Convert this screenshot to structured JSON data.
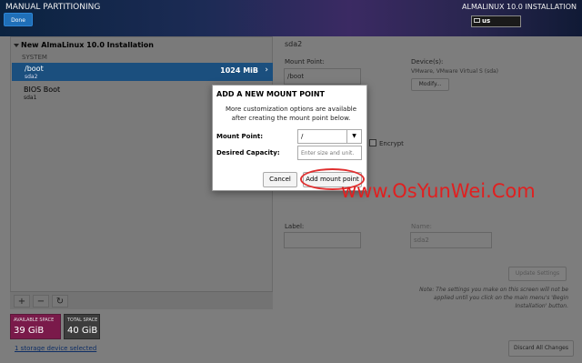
{
  "header": {
    "title": "MANUAL PARTITIONING",
    "done_label": "Done",
    "product": "ALMALINUX 10.0 INSTALLATION",
    "keyboard": "us"
  },
  "left_panel": {
    "install_title": "New AlmaLinux 10.0 Installation",
    "system_label": "SYSTEM",
    "selected": {
      "mount": "/boot",
      "device": "sda2",
      "size": "1024 MiB"
    },
    "items": [
      {
        "mount": "BIOS Boot",
        "device": "sda1"
      }
    ],
    "tools": {
      "add": "+",
      "remove": "−",
      "refresh": "↻"
    },
    "available_label": "AVAILABLE SPACE",
    "available_value": "39 GiB",
    "total_label": "TOTAL SPACE",
    "total_value": "40 GiB",
    "storage_link": "1 storage device selected"
  },
  "right_panel": {
    "title": "sda2",
    "mount_label": "Mount Point:",
    "mount_value": "/boot",
    "devices_label": "Device(s):",
    "devices_value": "VMware, VMware Virtual S (sda)",
    "modify_label": "Modify...",
    "encrypt_label": "Encrypt",
    "label_label": "Label:",
    "name_label": "Name:",
    "name_value": "sda2",
    "update_label": "Update Settings",
    "note": "Note: The settings you make on this screen will not be applied until you click on the main menu's 'Begin Installation' button.",
    "discard_label": "Discard All Changes"
  },
  "dialog": {
    "title": "ADD A NEW MOUNT POINT",
    "description": "More customization options are available after creating the mount point below.",
    "mount_label": "Mount Point:",
    "mount_value": "/",
    "capacity_label": "Desired Capacity:",
    "capacity_placeholder": "Enter size and unit.",
    "cancel_label": "Cancel",
    "add_label": "Add mount point"
  },
  "watermark": "www.OsYunWei.Com",
  "colors": {
    "accent": "#1f6fb8",
    "selected_row": "#1b4f7e",
    "available": "#7a1a4a",
    "highlight": "#e03030"
  }
}
